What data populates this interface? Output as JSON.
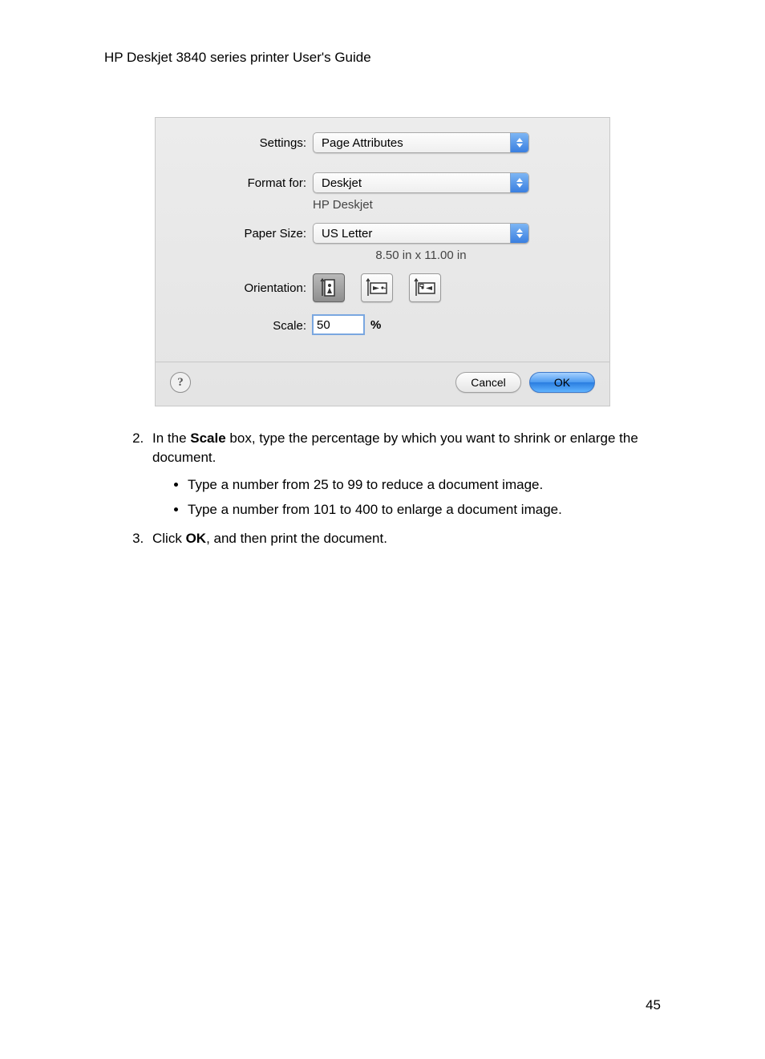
{
  "header": "HP Deskjet 3840 series printer User's Guide",
  "dialog": {
    "labels": {
      "settings": "Settings:",
      "format_for": "Format for:",
      "paper_size": "Paper Size:",
      "orientation": "Orientation:",
      "scale": "Scale:"
    },
    "settings_value": "Page Attributes",
    "format_for_value": "Deskjet",
    "format_for_sub": "HP Deskjet",
    "paper_size_value": "US Letter",
    "paper_size_sub": "8.50 in x 11.00 in",
    "scale_value": "50",
    "scale_suffix": "%",
    "help_symbol": "?",
    "cancel": "Cancel",
    "ok": "OK"
  },
  "step2": {
    "marker": "2.",
    "pre": "In the ",
    "bold": "Scale",
    "post": " box, type the percentage by which you want to shrink or enlarge the document."
  },
  "bullets": [
    "Type a number from 25 to 99 to reduce a document image.",
    "Type a number from 101 to 400 to enlarge a document image."
  ],
  "step3": {
    "marker": "3.",
    "pre": "Click ",
    "bold": "OK",
    "post": ", and then print the document."
  },
  "pagenum": "45"
}
